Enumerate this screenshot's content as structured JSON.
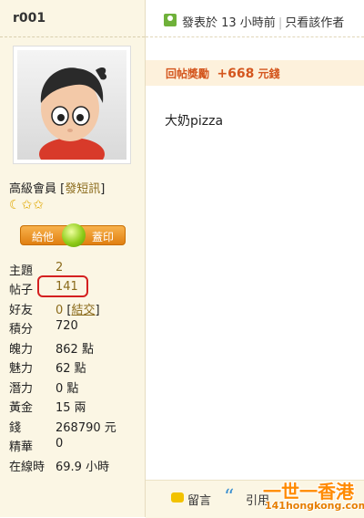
{
  "profile": {
    "username": "r001",
    "member_level": "高級會員",
    "pm_link": "發短訊",
    "award_left": "給他",
    "award_right": "蓋印",
    "stats": [
      {
        "key": "主題",
        "value": "2"
      },
      {
        "key": "帖子",
        "value": "141"
      },
      {
        "key": "好友",
        "value": "0",
        "link": "結交"
      },
      {
        "key": "積分",
        "value": "720"
      },
      {
        "key": "魄力",
        "value": "862 點"
      },
      {
        "key": "魅力",
        "value": "62 點"
      },
      {
        "key": "潛力",
        "value": "0 點"
      },
      {
        "key": "黃金",
        "value": "15 兩"
      },
      {
        "key": "錢",
        "value": "268790 元"
      },
      {
        "key": "精華",
        "value": "0"
      },
      {
        "key": "在線時",
        "value": "69.9 小時"
      }
    ]
  },
  "post": {
    "posted_at": "發表於 13 小時前",
    "only_author": "只看該作者",
    "reward_label": "回帖獎勵",
    "reward_amount": "+668",
    "reward_unit": "元錢",
    "content": "大奶pizza"
  },
  "footer": {
    "comment_label": "留言",
    "quote_label": "引用"
  },
  "watermark": {
    "title": "一世一香港",
    "url": "141hongkong.com"
  }
}
